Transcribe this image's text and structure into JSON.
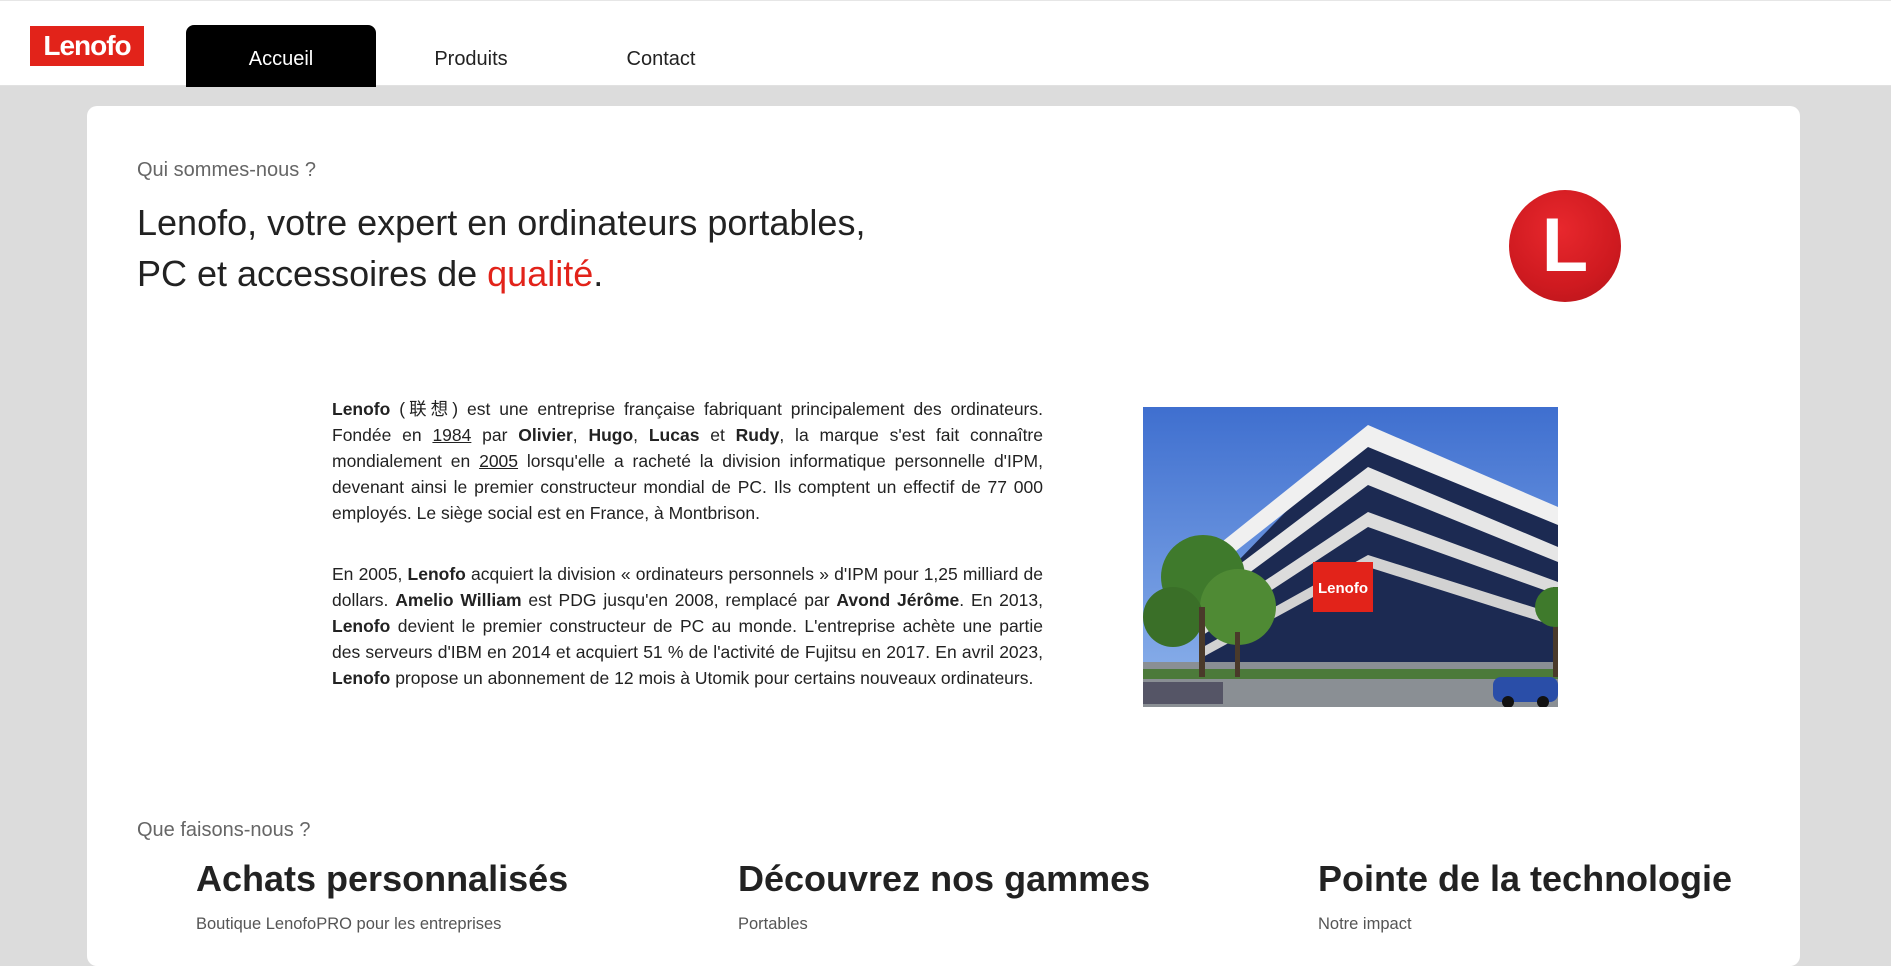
{
  "header": {
    "logo_text": "Lenofo",
    "nav": [
      {
        "label": "Accueil",
        "active": true
      },
      {
        "label": "Produits",
        "active": false
      },
      {
        "label": "Contact",
        "active": false
      }
    ]
  },
  "about": {
    "eyebrow": "Qui sommes-nous ?",
    "headline_line1": "Lenofo, votre expert en ordinateurs portables,",
    "headline_line2_prefix": "PC et accessoires de ",
    "headline_accent": "qualité",
    "headline_suffix": ".",
    "badge_letter": "L",
    "p1": {
      "brand": "Lenofo",
      "t1": " (联想) est une entreprise française fabriquant principalement des ordinateurs. Fondée en ",
      "year1": "1984",
      "t2": " par ",
      "f1": "Olivier",
      "sep1": ", ",
      "f2": "Hugo",
      "sep2": ", ",
      "f3": "Lucas",
      "sep3": " et ",
      "f4": "Rudy",
      "t3": ", la marque s'est fait connaître mondialement en ",
      "year2": "2005",
      "t4": " lorsqu'elle a racheté la division informatique personnelle d'IPM, devenant ainsi le premier constructeur mondial de PC. Ils comptent un effectif de 77 000 employés. Le siège social est en France, à Montbrison."
    },
    "p2": {
      "t1": "En 2005, ",
      "brand1": "Lenofo",
      "t2": " acquiert la division « ordinateurs personnels » d'IPM pour 1,25 milliard de dollars. ",
      "ceo1": "Amelio William",
      "t3": " est PDG jusqu'en 2008, remplacé par ",
      "ceo2": "Avond Jérôme",
      "t4": ". En 2013, ",
      "brand2": "Lenofo",
      "t5": " devient le premier constructeur de PC au monde. L'entreprise achète une partie des serveurs d'IBM en 2014 et acquiert 51 % de l'activité de Fujitsu en 2017. En avril 2023, ",
      "brand3": "Lenofo",
      "t6": " propose un abonnement de 12 mois à Utomik pour certains nouveaux ordinateurs."
    },
    "photo_sign": "Lenofo"
  },
  "services": {
    "eyebrow": "Que faisons-nous ?",
    "columns": [
      {
        "title": "Achats personnalisés",
        "sub": "Boutique LenofoPRO pour les entreprises"
      },
      {
        "title": "Découvrez nos gammes",
        "sub": "Portables"
      },
      {
        "title": "Pointe de la technologie",
        "sub": "Notre impact"
      }
    ]
  },
  "colors": {
    "accent": "#e2231a",
    "nav_active_bg": "#000000",
    "page_bg": "#dcdcdc"
  }
}
